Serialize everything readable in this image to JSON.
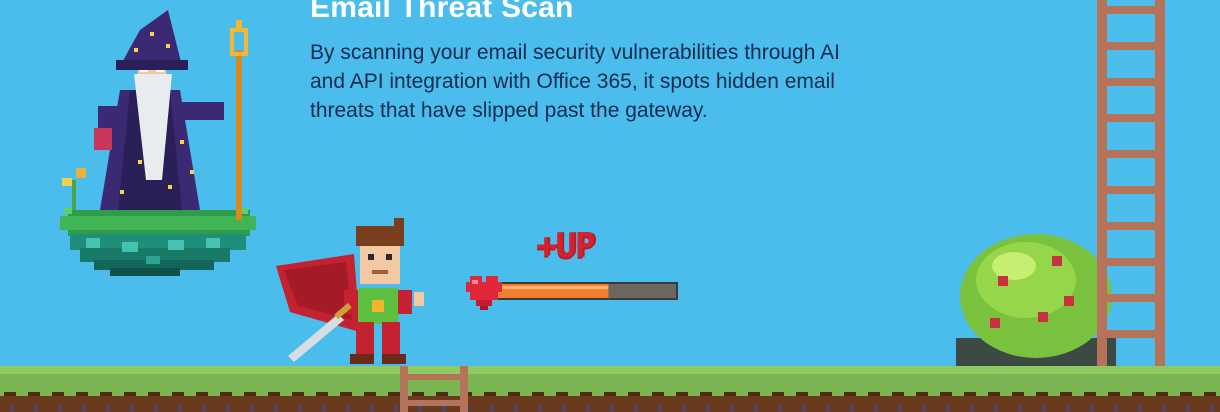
{
  "section": {
    "title": "Email Threat Scan",
    "description": "By scanning your email security vulnerabilities through AI and API integration with Office 365, it spots hidden email threats that have slipped past the gateway."
  },
  "scene": {
    "upgrade_label": "+UP",
    "progress_fraction": 0.62,
    "colors": {
      "sky": "#4bbdec",
      "grass": "#7bb552",
      "dirt": "#6a3a1e",
      "ladder": "#b5735a",
      "heart": "#e2263a",
      "progress_fill": "#f08030",
      "progress_track": "#55514a"
    },
    "icons": [
      "wizard-sprite",
      "hero-sprite",
      "heart-icon",
      "bush-sprite",
      "ladder-sprite",
      "floating-island-sprite",
      "grass-ground"
    ]
  }
}
